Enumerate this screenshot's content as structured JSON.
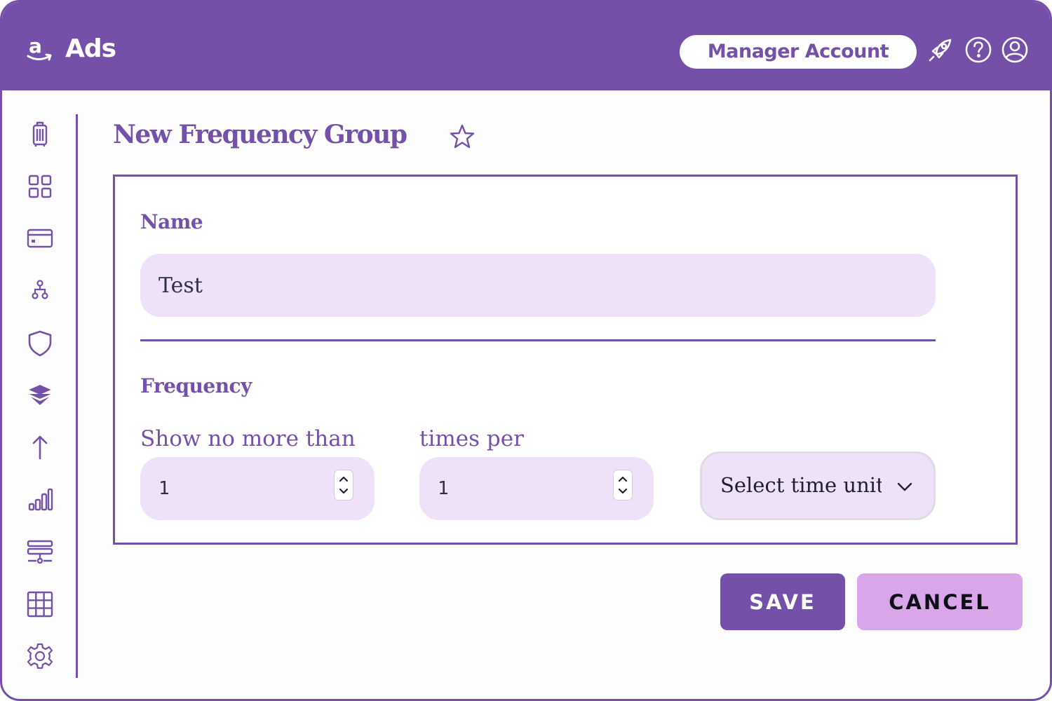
{
  "header": {
    "app_name": "Ads",
    "logo_icon": "amazon-a-icon",
    "manager_account_label": "Manager Account",
    "icons": [
      "rocket-icon",
      "help-icon",
      "user-icon"
    ]
  },
  "sidebar": {
    "icons": [
      "luggage-icon",
      "grid-icon",
      "credit-card-icon",
      "hierarchy-icon",
      "shield-icon",
      "layers-icon",
      "arrow-up-icon",
      "bar-chart-icon",
      "server-icon",
      "table-icon",
      "gear-icon"
    ]
  },
  "page": {
    "title": "New Frequency Group",
    "favorite_icon": "star-icon"
  },
  "form": {
    "name_label": "Name",
    "name_value": "Test",
    "frequency_label": "Frequency",
    "show_no_more_than_label": "Show no more than",
    "times_per_label": "times per",
    "show_value": "1",
    "times_value": "1",
    "time_unit_placeholder": "Select time unit"
  },
  "actions": {
    "save_label": "SAVE",
    "cancel_label": "CANCEL"
  },
  "colors": {
    "brand": "#7550a8",
    "input_fill": "#efe1f7",
    "cancel_fill": "#d9a6ea"
  }
}
